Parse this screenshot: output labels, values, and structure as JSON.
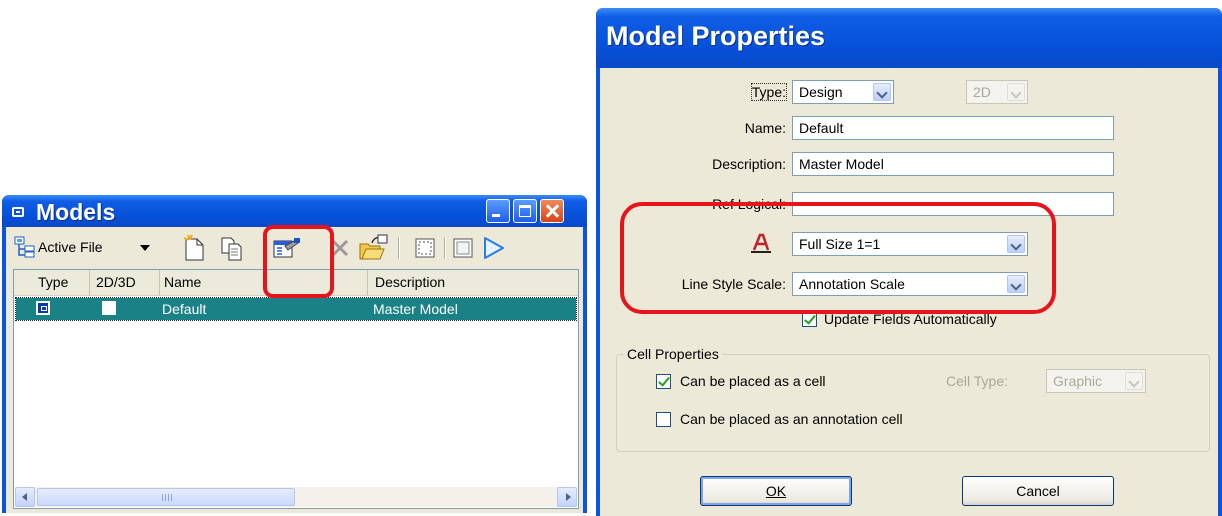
{
  "models_window": {
    "title": "Models",
    "toolbar": {
      "active_file_label": "Active File"
    },
    "columns": [
      "Type",
      "2D/3D",
      "Name",
      "Description"
    ],
    "rows": [
      {
        "name": "Default",
        "description": "Master Model",
        "selected": true
      }
    ],
    "scrollbar_grip": "III"
  },
  "properties_dialog": {
    "title": "Model Properties",
    "type_label": "Type:",
    "type_value": "Design",
    "dim_value": "2D",
    "name_label": "Name:",
    "name_value": "Default",
    "description_label": "Description:",
    "description_value": "Master Model",
    "ref_logical_label": "Ref Logical:",
    "ref_logical_value": "",
    "annotation_scale_value": "Full Size 1=1",
    "line_style_scale_label": "Line Style Scale:",
    "line_style_scale_value": "Annotation Scale",
    "update_fields_label": "Update Fields Automatically",
    "update_fields_checked": true,
    "cell_properties": {
      "group_title": "Cell Properties",
      "placed_as_cell_label": "Can be placed as a cell",
      "placed_as_cell_checked": true,
      "cell_type_label": "Cell Type:",
      "cell_type_value": "Graphic",
      "placed_as_annotation_label": "Can be placed as an annotation cell",
      "placed_as_annotation_checked": false
    },
    "ok_label": "OK",
    "cancel_label": "Cancel"
  },
  "colors": {
    "titlebar": "#0a54e3",
    "selection": "#1a8287",
    "highlight": "#e8141c",
    "window_face": "#ece9d8"
  }
}
